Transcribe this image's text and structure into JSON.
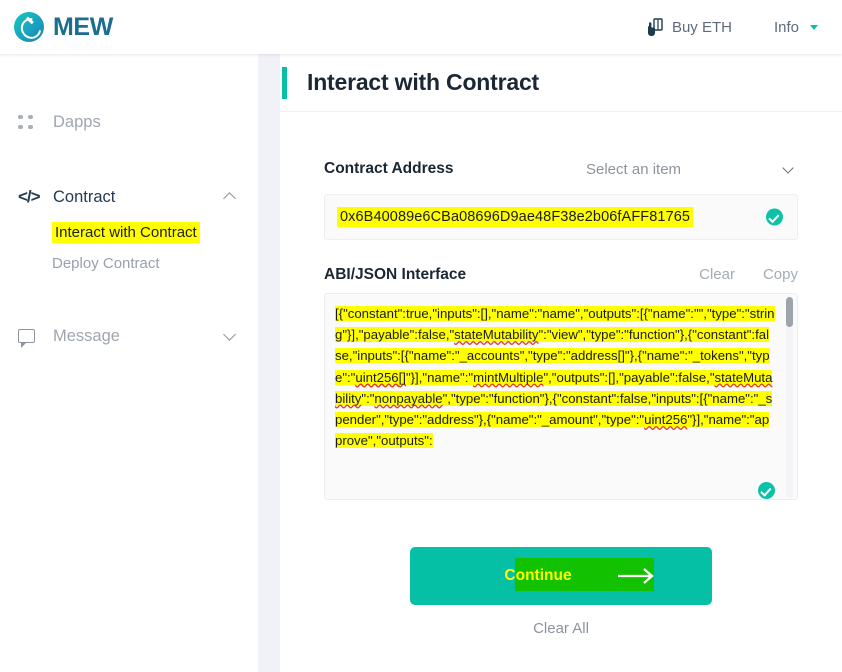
{
  "header": {
    "brand": "MEW",
    "brand_icon": "mew-logo-icon",
    "buy_eth_label": "Buy ETH",
    "buy_eth_icon": "buy-eth-card-icon",
    "info_label": "Info",
    "info_caret_icon": "caret-down-icon",
    "accent_color": "#05c0a5",
    "brand_color": "#1b6e8f"
  },
  "sidebar": {
    "items": [
      {
        "label": "Dapps",
        "icon": "dots-grid-icon",
        "expandable": false,
        "active": false
      },
      {
        "label": "Contract",
        "icon": "code-brackets-icon",
        "expandable": true,
        "expanded": true,
        "chevron_icon": "chevron-up-icon",
        "active": true
      },
      {
        "label": "Message",
        "icon": "speech-bubble-icon",
        "expandable": true,
        "expanded": false,
        "chevron_icon": "chevron-down-icon",
        "active": false
      }
    ],
    "contract_subitems": [
      {
        "label": "Interact with Contract",
        "selected": true,
        "highlighted": true
      },
      {
        "label": "Deploy Contract",
        "selected": false,
        "highlighted": false
      }
    ]
  },
  "main": {
    "page_title": "Interact with Contract",
    "contract_address": {
      "label": "Contract Address",
      "select_value": "Select an item",
      "select_chevron_icon": "chevron-down-icon",
      "input_value": "0x6B40089e6CBa08696D9ae48F38e2b06fAFF81765",
      "input_highlighted": true,
      "valid_icon": "check-circle-icon",
      "valid": true
    },
    "abi": {
      "label": "ABI/JSON Interface",
      "clear_label": "Clear",
      "copy_label": "Copy",
      "valid_icon": "check-circle-icon",
      "valid": true,
      "value": "[{\"constant\":true,\"inputs\":[],\"name\":\"name\",\"outputs\":[{\"name\":\"\",\"type\":\"string\"}],\"payable\":false,\"stateMutability\":\"view\",\"type\":\"function\"},{\"constant\":false,\"inputs\":[{\"name\":\"_accounts\",\"type\":\"address[]\"},{\"name\":\"_tokens\",\"type\":\"uint256[]\"}],\"name\":\"mintMultiple\",\"outputs\":[],\"payable\":false,\"stateMutability\":\"nonpayable\",\"type\":\"function\"},{\"constant\":false,\"inputs\":[{\"name\":\"_spender\",\"type\":\"address\"},{\"name\":\"_amount\",\"type\":\"uint256\"}],\"name\":\"approve\",\"outputs\":",
      "misspelled_words": [
        "stateMutability",
        "uint256[]",
        "mintMultiple",
        "nonpayable",
        "uint256"
      ],
      "scrollbar_at_top": true
    },
    "continue_button": {
      "label": "Continue",
      "arrow_icon": "arrow-right-icon",
      "highlighted": true,
      "button_color": "#05c0a5",
      "highlight_color": "#12c200",
      "label_color": "#ffff00"
    },
    "clear_all_label": "Clear All"
  },
  "highlight_color": "#ffff00"
}
